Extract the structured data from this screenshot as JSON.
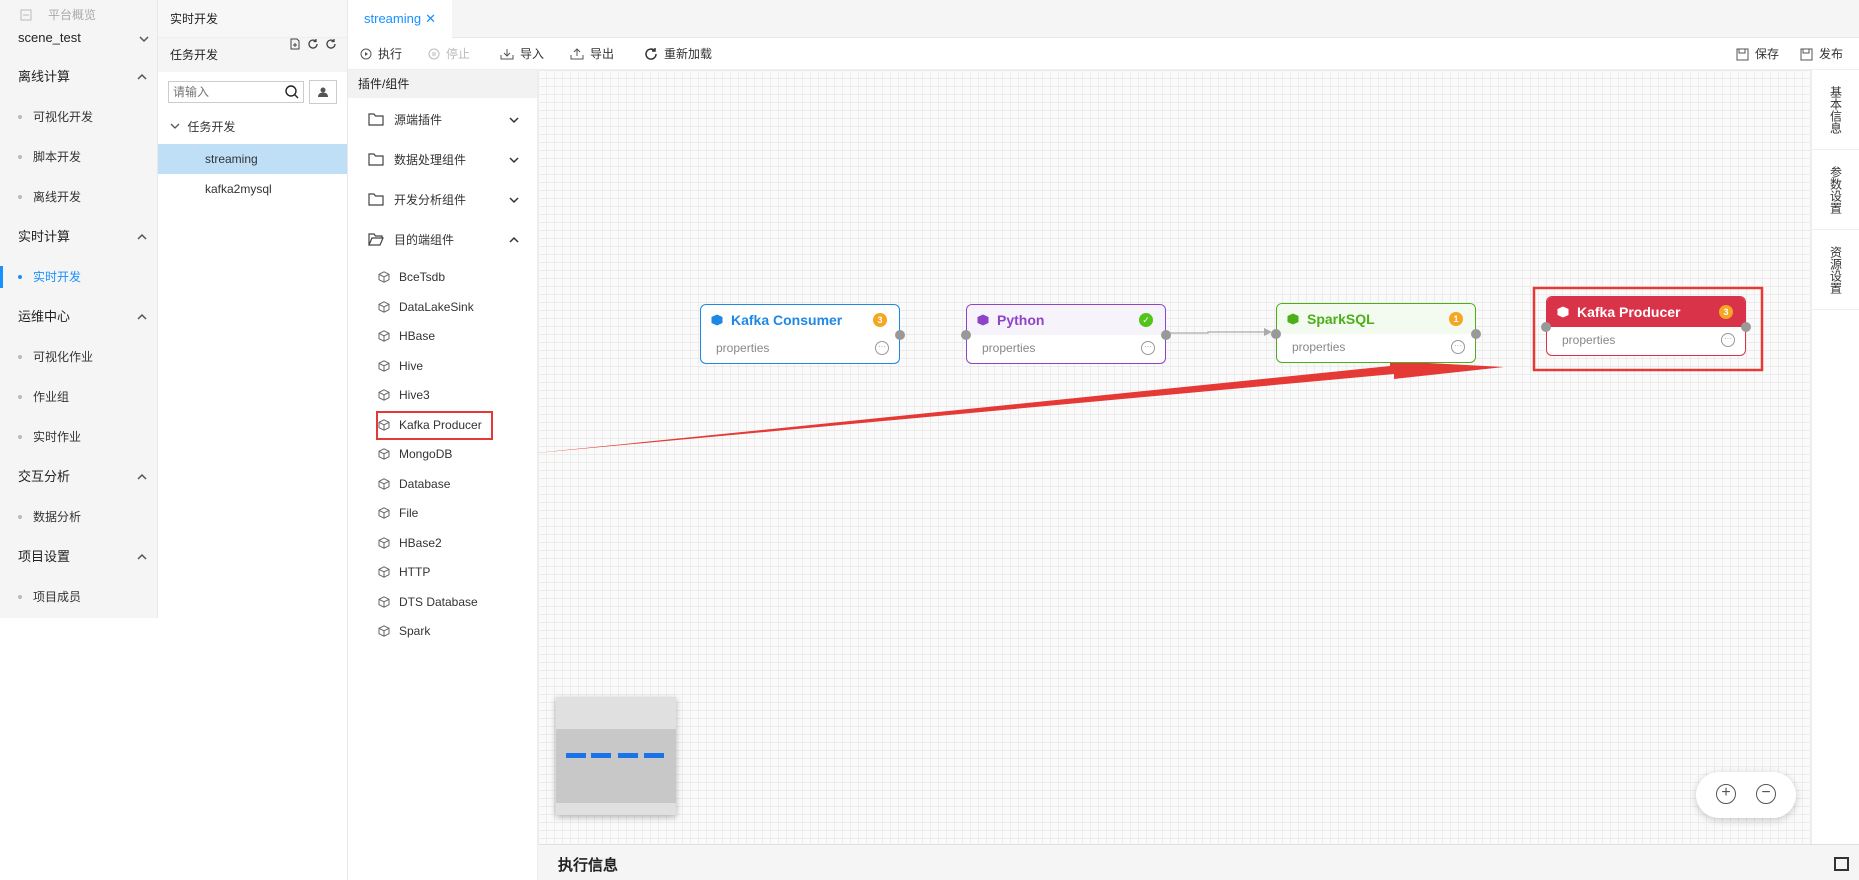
{
  "leftnav": {
    "overview": "平台概览",
    "project": "scene_test",
    "groups": [
      {
        "label": "离线计算",
        "items": [
          "可视化开发",
          "脚本开发",
          "离线开发"
        ]
      },
      {
        "label": "实时计算",
        "items": [
          "实时开发"
        ]
      },
      {
        "label": "运维中心",
        "items": [
          "可视化作业",
          "作业组",
          "实时作业"
        ]
      },
      {
        "label": "交互分析",
        "items": [
          "数据分析"
        ]
      },
      {
        "label": "项目设置",
        "items": [
          "项目成员"
        ]
      }
    ]
  },
  "tasktree": {
    "header": "实时开发",
    "subheader": "任务开发",
    "search_placeholder": "请输入",
    "folder": "任务开发",
    "nodes": [
      "streaming",
      "kafka2mysql"
    ]
  },
  "tab": {
    "label": "streaming",
    "close": "✕"
  },
  "toolbar": {
    "run": "执行",
    "stop": "停止",
    "import": "导入",
    "export": "导出",
    "reload": "重新加载",
    "save": "保存",
    "publish": "发布"
  },
  "plugins": {
    "header": "插件/组件",
    "categories": [
      "源端插件",
      "数据处理组件",
      "开发分析组件",
      "目的端组件"
    ],
    "items": [
      "BceTsdb",
      "DataLakeSink",
      "HBase",
      "Hive",
      "Hive3",
      "Kafka Producer",
      "MongoDB",
      "Database",
      "File",
      "HBase2",
      "HTTP",
      "DTS Database",
      "Spark"
    ]
  },
  "rightrail": [
    "基本信息",
    "参数设置",
    "资源设置"
  ],
  "graph": {
    "nodes": [
      {
        "name": "Kafka Consumer",
        "props": "properties",
        "badge": "3",
        "color": "#1e88e5",
        "badge_color": "#f5a623"
      },
      {
        "name": "Python",
        "props": "properties",
        "badge": "✓",
        "color": "#8e44c9",
        "badge_color": "#52c41a"
      },
      {
        "name": "SparkSQL",
        "props": "properties",
        "badge": "1",
        "color": "#4caf1a",
        "badge_color": "#f5a623"
      },
      {
        "name": "Kafka Producer",
        "props": "properties",
        "badge": "3",
        "color": "#d9334a",
        "badge_color": "#f5a623"
      }
    ]
  },
  "exec": {
    "title": "执行信息"
  }
}
